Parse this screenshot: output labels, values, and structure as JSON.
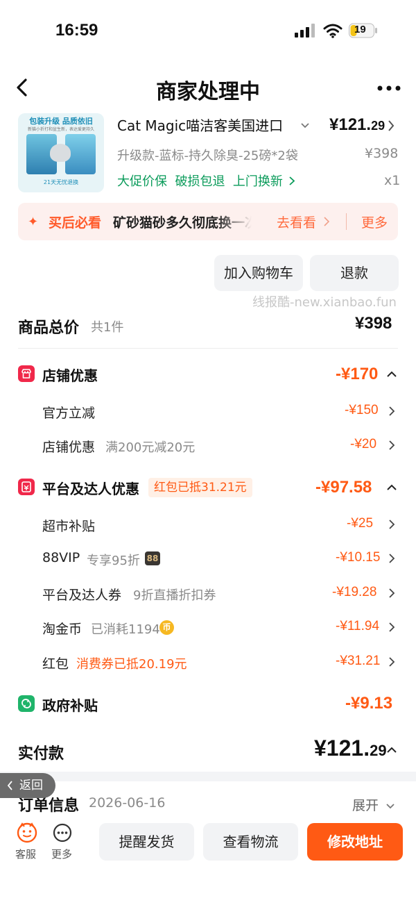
{
  "status_bar": {
    "time": "16:59",
    "battery": "19"
  },
  "nav": {
    "title": "商家处理中"
  },
  "product": {
    "thumb_title": "包装升级 品质依旧",
    "thumb_subtitle": "新猫小折打和盆生新，表达爱更持久",
    "thumb_footer": "21天无忧退换",
    "name": "Cat Magic喵洁客美国进口",
    "price_int": "¥121.",
    "price_dec": "29",
    "sku": "升级款-蓝标-持久除臭-25磅*2袋",
    "original_price": "¥398",
    "promo": "大促价保  破损包退  上门换新",
    "quantity": "x1"
  },
  "tip_bar": {
    "label": "买后必看",
    "text": "矿砂猫砂多久彻底换一次",
    "go": "去看看",
    "more": "更多"
  },
  "actions": {
    "add_cart": "加入购物车",
    "refund": "退款"
  },
  "watermark": "线报酷-new.xianbao.fun",
  "summary": {
    "total_label": "商品总价",
    "total_count": "共1件",
    "total_value": "¥398"
  },
  "shop_discount": {
    "title": "店铺优惠",
    "value": "-¥170",
    "items": [
      {
        "label": "官方立减",
        "note": "",
        "value": "-¥150"
      },
      {
        "label": "店铺优惠",
        "note": "满200元减20元",
        "value": "-¥20"
      }
    ]
  },
  "platform_discount": {
    "title": "平台及达人优惠",
    "tag": "红包已抵31.21元",
    "value": "-¥97.58",
    "items": [
      {
        "label": "超市补贴",
        "note": "",
        "value": "-¥25"
      },
      {
        "label": "88VIP",
        "note": "专享95折",
        "badge": "88",
        "value": "-¥10.15"
      },
      {
        "label": "平台及达人券",
        "note": "9折直播折扣券",
        "value": "-¥19.28"
      },
      {
        "label": "淘金币",
        "note": "已消耗1194",
        "badge": "币",
        "value": "-¥11.94"
      },
      {
        "label": "红包",
        "note": "消费券已抵20.19元",
        "value": "-¥31.21"
      }
    ]
  },
  "gov_subsidy": {
    "title": "政府补贴",
    "value": "-¥9.13"
  },
  "paid": {
    "label": "实付款",
    "value_int": "¥121.",
    "value_dec": "29"
  },
  "order_info": {
    "label": "订单信息",
    "date": "2026-06-16",
    "expand": "展开"
  },
  "back_pill": "返回",
  "bottom": {
    "kefu": "客服",
    "more": "更多",
    "remind": "提醒发货",
    "logistics": "查看物流",
    "change_address": "修改地址"
  },
  "colors": {
    "accent": "#ff5a14",
    "promo_green": "#0a9b5a",
    "shop_red": "#f0284a",
    "gov_green": "#1fb46a"
  }
}
